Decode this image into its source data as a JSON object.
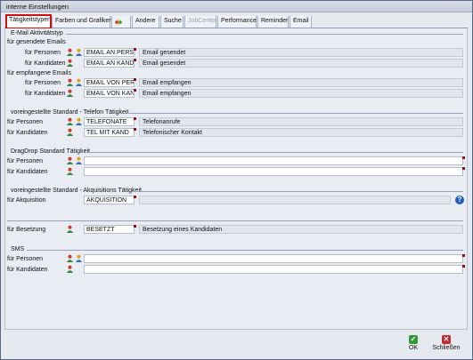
{
  "window": {
    "title": "interne Einstellungen"
  },
  "tabs": [
    {
      "label": "Tätigkeitstypen"
    },
    {
      "label": "Farben und Grafiken"
    },
    {
      "label": "Andere"
    },
    {
      "label": "Suche"
    },
    {
      "label": "JobCenter"
    },
    {
      "label": "Performance"
    },
    {
      "label": "Reminder"
    },
    {
      "label": "Email"
    }
  ],
  "email": {
    "heading": "E-Mail Aktivitätstyp",
    "sent_label": "für gesendete Emails",
    "received_label": "für empfangene Emails",
    "rows": [
      {
        "label": "für Personen",
        "code": "EMAIL AN PERS",
        "desc": "Email gesendet"
      },
      {
        "label": "für Kandidaten",
        "code": "EMAIL AN KAND",
        "desc": "Email gesendet"
      },
      {
        "label": "für Personen",
        "code": "EMAIL VON PERS",
        "desc": "Email empfangen"
      },
      {
        "label": "für Kandidaten",
        "code": "EMAIL VON KAND",
        "desc": "Email empfangen"
      }
    ]
  },
  "telefon": {
    "heading": "voreingestellte Standard - Telefon Tätigkeit",
    "rows": [
      {
        "label": "für Personen",
        "code": "TELEFONATE",
        "desc": "Telefonanrufe"
      },
      {
        "label": "für Kandidaten",
        "code": "TEL MIT KAND",
        "desc": "Telefonischer Kontakt"
      }
    ]
  },
  "dragdrop": {
    "heading": "DragDrop Standard Tätigkeit",
    "rows": [
      {
        "label": "für Personen",
        "code": ""
      },
      {
        "label": "für Kandidaten",
        "code": ""
      }
    ]
  },
  "akquisition": {
    "heading": "voreingestellte Standard - Akquisitions Tätigkeit",
    "row": {
      "label": "für Akquisition",
      "code": "AKQUISITION",
      "desc": ""
    }
  },
  "besetzung": {
    "row": {
      "label": "für Besetzung",
      "code": "BESETZT",
      "desc": "Besetzung eines Kandidaten"
    }
  },
  "sms": {
    "heading": "SMS",
    "rows": [
      {
        "label": "für Personen",
        "code": ""
      },
      {
        "label": "für Kandidaten",
        "code": ""
      }
    ]
  },
  "buttons": {
    "ok": "OK",
    "close": "Schließen"
  },
  "colors": {
    "accent_highlight": "#d01010",
    "ok_green": "#2e9a3a",
    "close_red": "#c0282b",
    "help_blue": "#1f5fbf"
  }
}
